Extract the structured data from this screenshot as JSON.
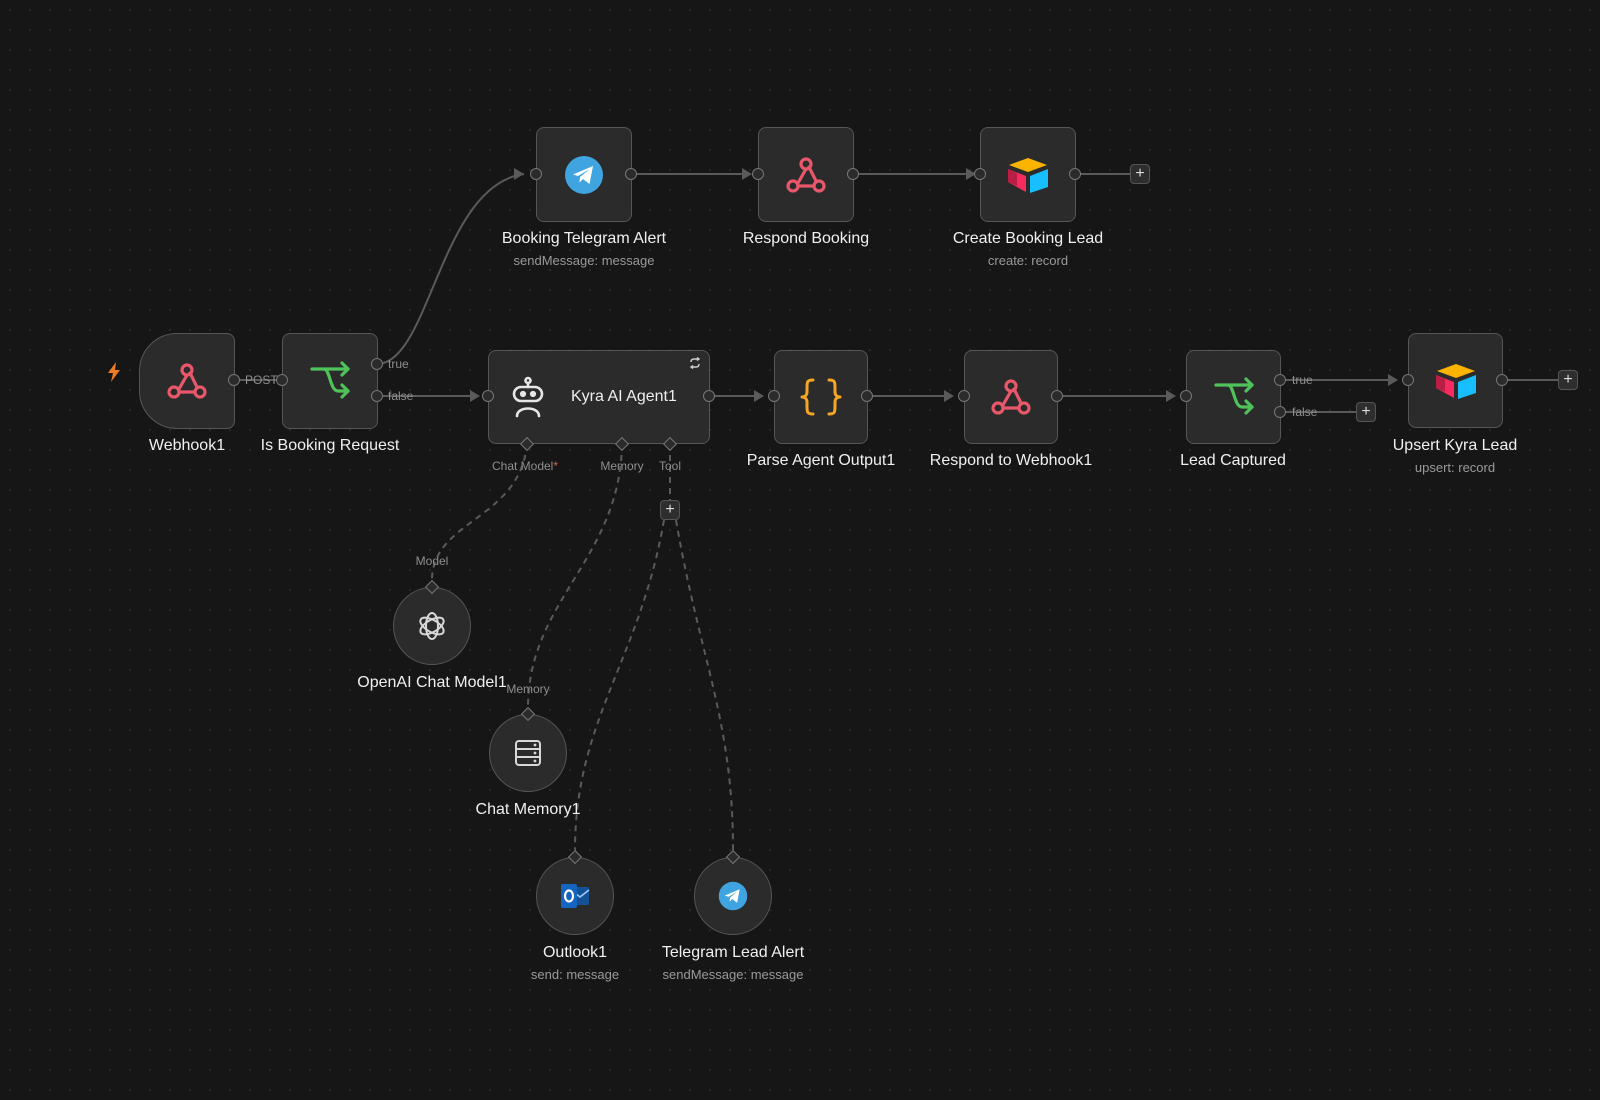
{
  "colors": {
    "webhook": "#e8576a",
    "telegram": "#3fa4e0",
    "ifnode": "#4fc25a",
    "code": "#f5a623",
    "trigger_bolt": "#f07a22"
  },
  "nodes": {
    "webhook1": {
      "label": "Webhook1",
      "port": "POST",
      "icon": "webhook-icon"
    },
    "is_booking": {
      "label": "Is Booking Request",
      "true": "true",
      "false": "false",
      "icon": "branch-icon"
    },
    "booking_telegram": {
      "label": "Booking Telegram Alert",
      "subtitle": "sendMessage: message",
      "icon": "telegram-icon"
    },
    "respond_booking": {
      "label": "Respond Booking",
      "icon": "webhook-icon"
    },
    "create_booking_lead": {
      "label": "Create Booking Lead",
      "subtitle": "create: record",
      "icon": "airtable-icon"
    },
    "agent": {
      "title": "Kyra AI Agent1",
      "chat_model": "Chat Model",
      "required_mark": "*",
      "memory": "Memory",
      "tool": "Tool",
      "icon": "robot-icon"
    },
    "parse": {
      "label": "Parse Agent Output1",
      "icon": "code-braces-icon"
    },
    "respond_webhook": {
      "label": "Respond to Webhook1",
      "icon": "webhook-icon"
    },
    "lead_captured": {
      "label": "Lead Captured",
      "true": "true",
      "false": "false",
      "icon": "branch-icon"
    },
    "upsert": {
      "label": "Upsert Kyra Lead",
      "subtitle": "upsert: record",
      "icon": "airtable-icon"
    },
    "openai": {
      "label": "OpenAI Chat Model1",
      "port": "Model",
      "icon": "openai-icon"
    },
    "chat_memory": {
      "label": "Chat Memory1",
      "port": "Memory",
      "icon": "database-icon"
    },
    "outlook": {
      "label": "Outlook1",
      "subtitle": "send: message",
      "icon": "outlook-icon"
    },
    "telegram_lead": {
      "label": "Telegram Lead Alert",
      "subtitle": "sendMessage: message",
      "icon": "telegram-icon"
    }
  },
  "plus_label": "+"
}
